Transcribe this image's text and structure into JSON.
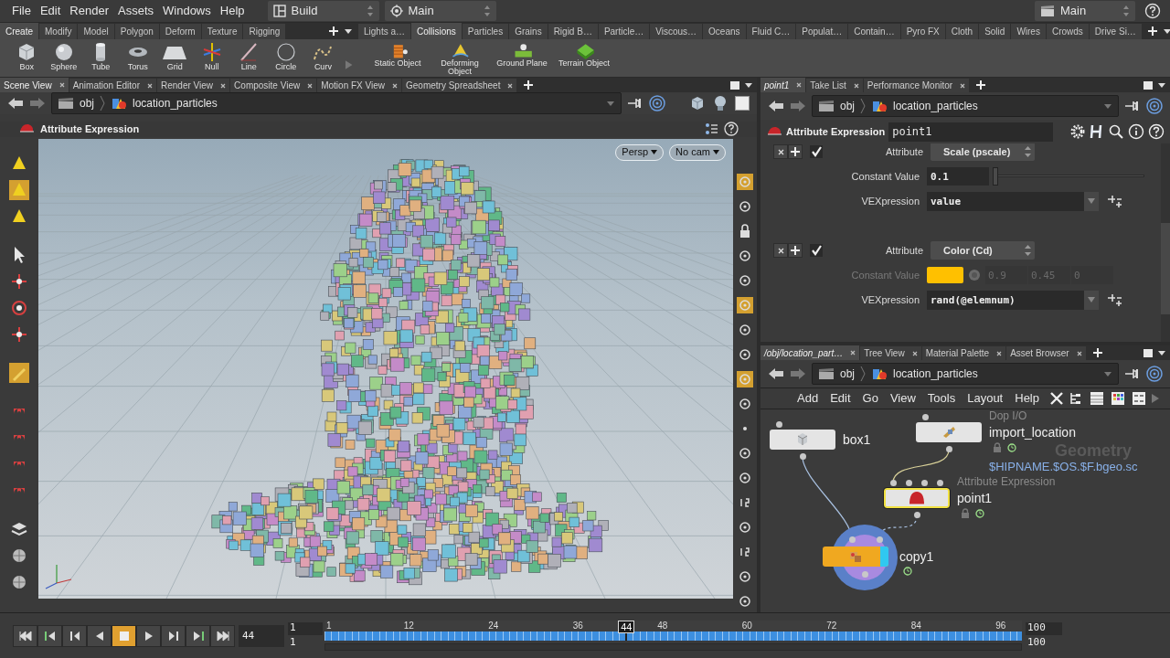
{
  "menu_bar": {
    "menus": [
      "File",
      "Edit",
      "Render",
      "Assets",
      "Windows",
      "Help"
    ],
    "desktop": "Build",
    "context": "Main",
    "right_context": "Main"
  },
  "shelf_left": {
    "tabs": [
      {
        "label": "Create",
        "selected": true
      },
      {
        "label": "Modify",
        "selected": false
      },
      {
        "label": "Model",
        "selected": false
      },
      {
        "label": "Polygon",
        "selected": false
      },
      {
        "label": "Deform",
        "selected": false
      },
      {
        "label": "Texture",
        "selected": false
      },
      {
        "label": "Rigging",
        "selected": false
      }
    ],
    "tools": [
      "Box",
      "Sphere",
      "Tube",
      "Torus",
      "Grid",
      "Null",
      "Line",
      "Circle",
      "Curv"
    ]
  },
  "shelf_right": {
    "tabs": [
      {
        "label": "Lights a…",
        "selected": false
      },
      {
        "label": "Collisions",
        "selected": true
      },
      {
        "label": "Particles",
        "selected": false
      },
      {
        "label": "Grains",
        "selected": false
      },
      {
        "label": "Rigid B…",
        "selected": false
      },
      {
        "label": "Particle…",
        "selected": false
      },
      {
        "label": "Viscous…",
        "selected": false
      },
      {
        "label": "Oceans",
        "selected": false
      },
      {
        "label": "Fluid C…",
        "selected": false
      },
      {
        "label": "Populat…",
        "selected": false
      },
      {
        "label": "Contain…",
        "selected": false
      },
      {
        "label": "Pyro FX",
        "selected": false
      },
      {
        "label": "Cloth",
        "selected": false
      },
      {
        "label": "Solid",
        "selected": false
      },
      {
        "label": "Wires",
        "selected": false
      },
      {
        "label": "Crowds",
        "selected": false
      },
      {
        "label": "Drive Si…",
        "selected": false
      }
    ],
    "tools": [
      "Static Object",
      "Deforming Object",
      "Ground Plane",
      "Terrain Object"
    ]
  },
  "scene_pane": {
    "tabs": [
      {
        "label": "Scene View",
        "selected": true
      },
      {
        "label": "Animation Editor",
        "selected": false
      },
      {
        "label": "Render View",
        "selected": false
      },
      {
        "label": "Composite View",
        "selected": false
      },
      {
        "label": "Motion FX View",
        "selected": false
      },
      {
        "label": "Geometry Spreadsheet",
        "selected": false
      }
    ],
    "path": [
      "obj",
      "location_particles"
    ],
    "operator": "Attribute Expression",
    "view_buttons": [
      "Persp",
      "No cam"
    ]
  },
  "parameter_pane": {
    "tabs": [
      {
        "label": "point1",
        "selected": true
      },
      {
        "label": "Take List",
        "selected": false
      },
      {
        "label": "Performance Monitor",
        "selected": false
      }
    ],
    "path": [
      "obj",
      "location_particles"
    ],
    "node_type": "Attribute Expression",
    "node_name": "point1",
    "blocks": [
      {
        "kind": "float",
        "enabled": true,
        "attribute_label": "Attribute",
        "attribute": "Scale (pscale)",
        "value_label": "Constant Value",
        "value_disabled": false,
        "value": "0.1",
        "level": 0.0,
        "expression_label": "VEXpression",
        "expression": "value"
      },
      {
        "kind": "color",
        "enabled": true,
        "attribute_label": "Attribute",
        "attribute": "Color (Cd)",
        "value_label": "Constant Value",
        "value_disabled": true,
        "color": "#ffc000",
        "values": [
          "0.9",
          "0.45",
          "0"
        ],
        "expression_label": "VEXpression",
        "expression": "rand(@elemnum)"
      }
    ]
  },
  "network_pane": {
    "tabs": [
      {
        "label": "/obj/location_part…",
        "selected": true
      },
      {
        "label": "Tree View",
        "selected": false
      },
      {
        "label": "Material Palette",
        "selected": false
      },
      {
        "label": "Asset Browser",
        "selected": false
      }
    ],
    "path": [
      "obj",
      "location_particles"
    ],
    "menus": [
      "Add",
      "Edit",
      "Go",
      "View",
      "Tools",
      "Layout",
      "Help"
    ],
    "context_label": "Geometry",
    "nodes": [
      {
        "name": "box1",
        "selected": false,
        "display": false,
        "locked": false,
        "time_dependent": false
      },
      {
        "name": "import_location",
        "type_label": "Dop I/O",
        "comment": "$HIPNAME.$OS.$F.bgeo.sc",
        "selected": false,
        "display": false,
        "locked": true,
        "time_dependent": true
      },
      {
        "name": "point1",
        "type_label": "Attribute Expression",
        "selected": true,
        "display": false,
        "locked": true,
        "time_dependent": true
      },
      {
        "name": "copy1",
        "selected": false,
        "display": true,
        "locked": false,
        "time_dependent": true
      }
    ],
    "wire_styles": [
      {
        "dashed": false
      },
      {
        "dashed": false
      },
      {
        "dashed": true
      }
    ]
  },
  "timeline": {
    "transport": [
      {
        "selected": false
      },
      {
        "selected": false
      },
      {
        "selected": false
      },
      {
        "selected": false
      },
      {
        "selected": true
      },
      {
        "selected": false
      },
      {
        "selected": false
      },
      {
        "selected": false
      },
      {
        "selected": false
      }
    ],
    "frame": "44",
    "start": "1",
    "range_start": "1",
    "end": "100",
    "range_end": "100",
    "ticks": [
      "1",
      "12",
      "24",
      "36",
      "48",
      "60",
      "72",
      "84",
      "96"
    ],
    "current": "44",
    "level": 0.434
  }
}
